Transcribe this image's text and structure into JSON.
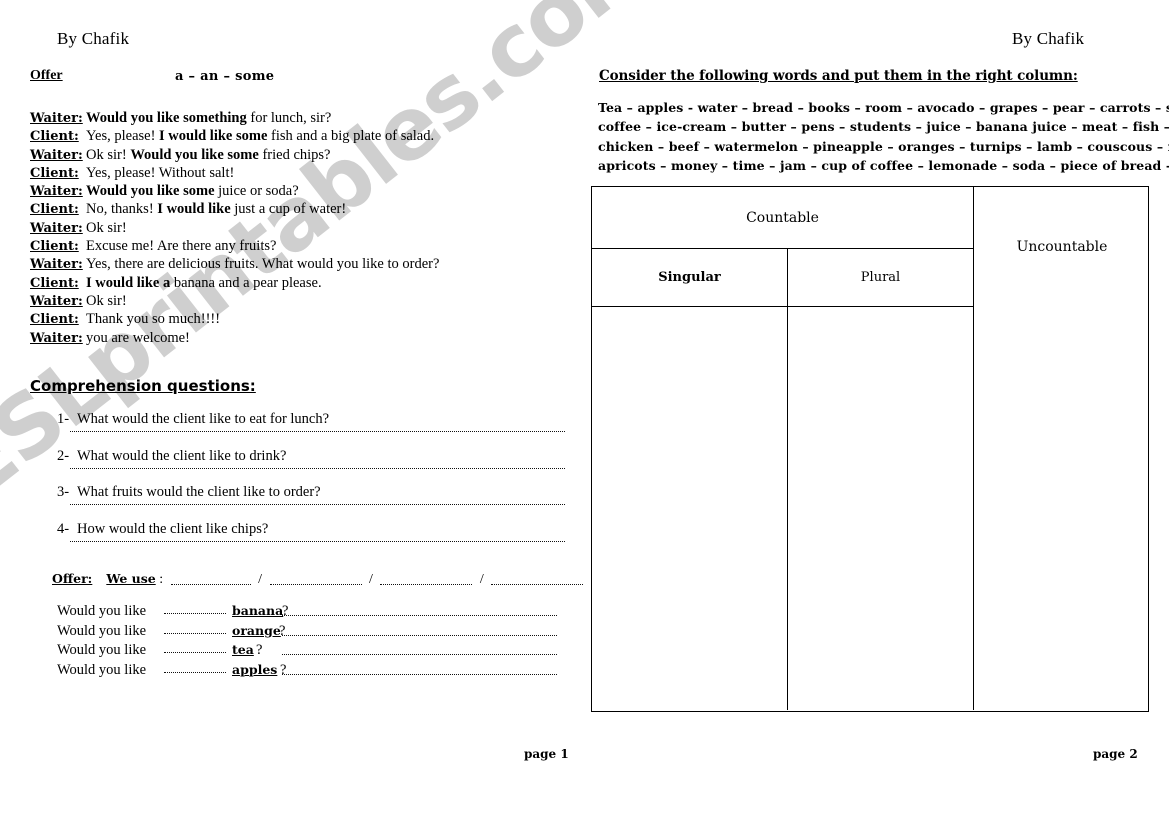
{
  "document": {
    "watermark": "ESLprintables.com",
    "byline_left": "By Chafik",
    "byline_right": "By Chafik",
    "page_left_label": "page 1",
    "page_right_label": "page 2"
  },
  "left_page": {
    "offer_heading": "Offer",
    "articles": "a – an – some",
    "dialogue": [
      {
        "speaker": "Waiter:",
        "bold_lead": "Would you like something",
        "rest": " for lunch, sir?"
      },
      {
        "speaker": "Client:",
        "plain_lead": "Yes, please! ",
        "bold_mid": "I would like some",
        "rest": " fish and a big plate of salad."
      },
      {
        "speaker": "Waiter:",
        "plain_lead": "Ok sir! ",
        "bold_mid": "Would you like some",
        "rest": " fried chips?"
      },
      {
        "speaker": "Client:",
        "plain_lead": "Yes, please! Without salt!",
        "bold_mid": "",
        "rest": ""
      },
      {
        "speaker": "Waiter:",
        "bold_lead": "Would you like some",
        "rest": " juice or soda?"
      },
      {
        "speaker": "Client:",
        "plain_lead": "No, thanks! ",
        "bold_mid": "I would like",
        "rest": " just a cup of water!"
      },
      {
        "speaker": "Waiter:",
        "plain_lead": "Ok sir!",
        "bold_mid": "",
        "rest": ""
      },
      {
        "speaker": "Client:",
        "plain_lead": "Excuse me! Are there any fruits?",
        "bold_mid": "",
        "rest": ""
      },
      {
        "speaker": "Waiter:",
        "plain_lead": "Yes, there are delicious fruits. What would you like to order?",
        "bold_mid": "",
        "rest": ""
      },
      {
        "speaker": "Client:",
        "plain_lead": " ",
        "bold_mid": "I would like a",
        "rest": " banana and a pear please."
      },
      {
        "speaker": "Waiter:",
        "plain_lead": "Ok sir!",
        "bold_mid": "",
        "rest": ""
      },
      {
        "speaker": "Client:",
        "plain_lead": "Thank you so much!!!!",
        "bold_mid": "",
        "rest": ""
      },
      {
        "speaker": "Waiter:",
        "plain_lead": "you are welcome!",
        "bold_mid": "",
        "rest": ""
      }
    ],
    "comprehension_heading": "Comprehension questions:",
    "questions": [
      {
        "num": "1-",
        "text": "What would the client like to eat for lunch?"
      },
      {
        "num": "2-",
        "text": "What would the client like to drink?"
      },
      {
        "num": "3-",
        "text": "What fruits would the client like to order?"
      },
      {
        "num": "4-",
        "text": "How would the client like chips?"
      }
    ],
    "offer_rule": {
      "label": "Offer:",
      "we_use": "We use",
      "colon": ":",
      "separator": "/"
    },
    "would_you_like": {
      "prefix": "Would you like",
      "items": [
        {
          "word": "banana",
          "mark": "?"
        },
        {
          "word": "orange",
          "mark": "?"
        },
        {
          "word": "tea",
          "mark": "?"
        },
        {
          "word": "apples",
          "mark": "?"
        }
      ]
    }
  },
  "right_page": {
    "instruction": "Consider the following words and put them in the right column:",
    "word_list_lines": [
      "Tea – apples - water – bread – books – room – avocado – grapes – pear – carrots – sugar –",
      "coffee – ice-cream – butter – pens – students – juice – banana juice – meat – fish – soup –",
      "chicken – beef – watermelon – pineapple – oranges – turnips – lamb – couscous – milk-",
      "apricots – money – time – jam – cup of coffee – lemonade – soda – piece of bread -"
    ],
    "table": {
      "countable_header": "Countable",
      "uncountable_header": "Uncountable",
      "singular_header": "Singular",
      "plural_header": "Plural"
    }
  }
}
